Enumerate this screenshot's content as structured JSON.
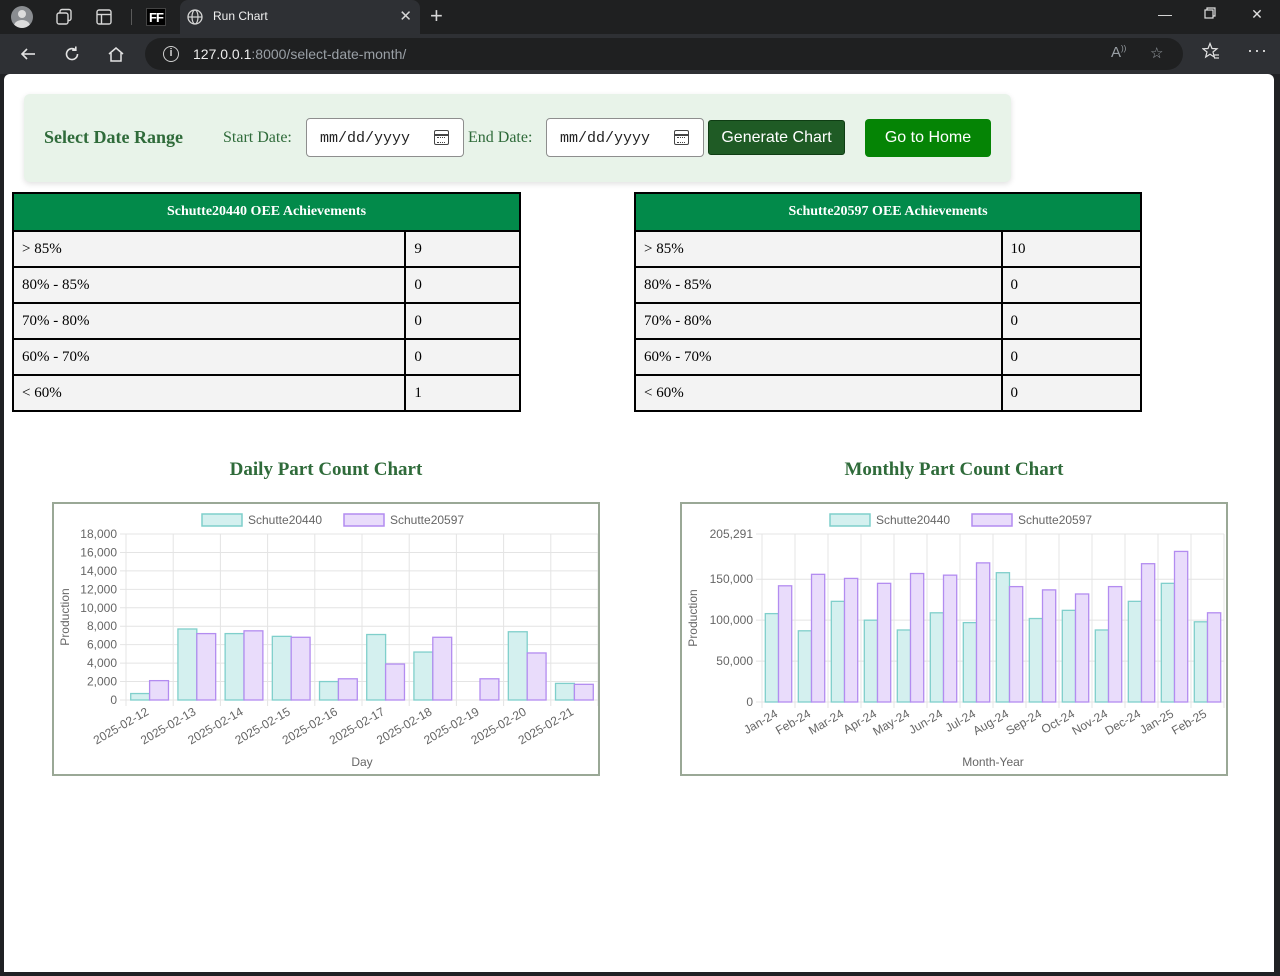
{
  "browser": {
    "ff_label": "FF",
    "tab_title": "Run Chart",
    "url_host": "127.0.0.1",
    "url_path": ":8000/select-date-month/"
  },
  "date_panel": {
    "title": "Select Date Range",
    "start_label": "Start Date:",
    "start_placeholder": "mm/dd/yyyy",
    "end_label": "End Date:",
    "end_placeholder": "mm/dd/yyyy",
    "generate_label": "Generate Chart",
    "home_label": "Go to Home"
  },
  "tables": [
    {
      "title": "Schutte20440 OEE Achievements",
      "rows": [
        {
          "range": "> 85%",
          "count": "9"
        },
        {
          "range": "80% - 85%",
          "count": "0"
        },
        {
          "range": "70% - 80%",
          "count": "0"
        },
        {
          "range": "60% - 70%",
          "count": "0"
        },
        {
          "range": "< 60%",
          "count": "1"
        }
      ]
    },
    {
      "title": "Schutte20597 OEE Achievements",
      "rows": [
        {
          "range": "> 85%",
          "count": "10"
        },
        {
          "range": "80% - 85%",
          "count": "0"
        },
        {
          "range": "70% - 80%",
          "count": "0"
        },
        {
          "range": "60% - 70%",
          "count": "0"
        },
        {
          "range": "< 60%",
          "count": "0"
        }
      ]
    }
  ],
  "colors": {
    "series1_fill": "#d4f0ef",
    "series1_stroke": "#7fcfcb",
    "series2_fill": "#e9dcfb",
    "series2_stroke": "#b38cf0",
    "title_green": "#2f6b3a"
  },
  "chart_data": [
    {
      "type": "bar",
      "title": "Daily Part Count Chart",
      "xlabel": "Day",
      "ylabel": "Production",
      "categories": [
        "2025-02-12",
        "2025-02-13",
        "2025-02-14",
        "2025-02-15",
        "2025-02-16",
        "2025-02-17",
        "2025-02-18",
        "2025-02-19",
        "2025-02-20",
        "2025-02-21"
      ],
      "series": [
        {
          "name": "Schutte20440",
          "values": [
            700,
            7700,
            7200,
            6900,
            2000,
            7100,
            5200,
            0,
            7400,
            1800
          ]
        },
        {
          "name": "Schutte20597",
          "values": [
            2100,
            7200,
            7500,
            6800,
            2300,
            3900,
            6800,
            2300,
            5100,
            1700
          ]
        }
      ],
      "ylim": [
        0,
        18000
      ],
      "yticks": [
        "18,000",
        "16,000",
        "14,000",
        "12,000",
        "10,000",
        "8,000",
        "6,000",
        "4,000",
        "2,000",
        "0"
      ],
      "legend": "top",
      "grid": true
    },
    {
      "type": "bar",
      "title": "Monthly Part Count Chart",
      "xlabel": "Month-Year",
      "ylabel": "Production",
      "categories": [
        "Jan-24",
        "Feb-24",
        "Mar-24",
        "Apr-24",
        "May-24",
        "Jun-24",
        "Jul-24",
        "Aug-24",
        "Sep-24",
        "Oct-24",
        "Nov-24",
        "Dec-24",
        "Jan-25",
        "Feb-25"
      ],
      "series": [
        {
          "name": "Schutte20440",
          "values": [
            108000,
            87000,
            123000,
            100000,
            88000,
            109000,
            97000,
            158000,
            102000,
            112000,
            88000,
            123000,
            145000,
            98000
          ]
        },
        {
          "name": "Schutte20597",
          "values": [
            142000,
            156000,
            151000,
            145000,
            157000,
            155000,
            170000,
            141000,
            137000,
            132000,
            141000,
            169000,
            184000,
            109000
          ]
        }
      ],
      "ylim": [
        0,
        205291
      ],
      "yticks": [
        "205,291",
        "150,000",
        "100,000",
        "50,000",
        "0"
      ],
      "legend": "top",
      "grid": true
    }
  ]
}
